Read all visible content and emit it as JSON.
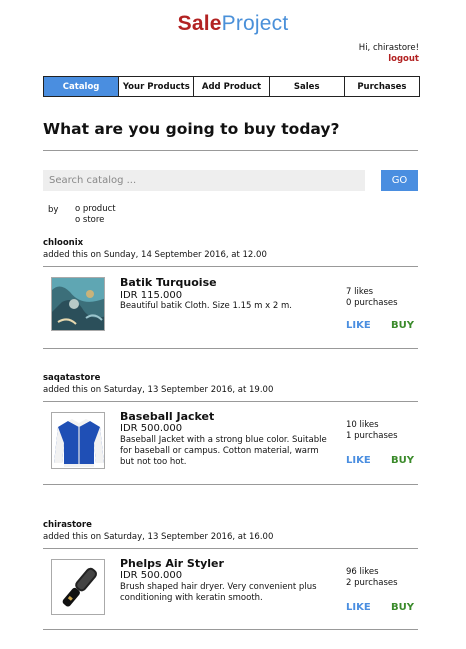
{
  "brand": {
    "sale": "Sale",
    "project": "Project",
    "colors": {
      "sale": "#b22222",
      "project": "#4a90d9",
      "accent": "#4a8ee0",
      "buy": "#3a8a2a"
    }
  },
  "user": {
    "greeting": "Hi, chirastore!",
    "logout": "logout"
  },
  "nav": {
    "tabs": [
      "Catalog",
      "Your Products",
      "Add Product",
      "Sales",
      "Purchases"
    ],
    "active": "Catalog"
  },
  "headline": "What are you going to buy today?",
  "search": {
    "placeholder": "Search catalog ...",
    "button": "GO",
    "by_label": "by",
    "options": [
      "o product",
      "o store"
    ]
  },
  "products": [
    {
      "seller": "chloonix",
      "added": "added this on Sunday, 14 September 2016, at 12.00",
      "name": "Batik Turquoise",
      "price": "IDR 115.000",
      "description": "Beautiful batik Cloth. Size 1.15 m x 2 m.",
      "likes": "7 likes",
      "purchases": "0 purchases",
      "like_label": "LIKE",
      "buy_label": "BUY",
      "image": "batik-cloth-photo"
    },
    {
      "seller": "saqatastore",
      "added": "added this on Saturday, 13 September 2016, at 19.00",
      "name": "Baseball Jacket",
      "price": "IDR 500.000",
      "description": "Baseball Jacket with a strong blue color. Suitable for baseball or campus. Cotton material, warm but not too hot.",
      "likes": "10 likes",
      "purchases": "1 purchases",
      "like_label": "LIKE",
      "buy_label": "BUY",
      "image": "blue-jacket-photo"
    },
    {
      "seller": "chirastore",
      "added": "added this on Saturday, 13 September 2016, at 16.00",
      "name": "Phelps Air Styler",
      "price": "IDR 500.000",
      "description": "Brush shaped hair dryer. Very convenient plus conditioning with keratin smooth.",
      "likes": "96 likes",
      "purchases": "2 purchases",
      "like_label": "LIKE",
      "buy_label": "BUY",
      "image": "hair-styler-photo"
    }
  ]
}
